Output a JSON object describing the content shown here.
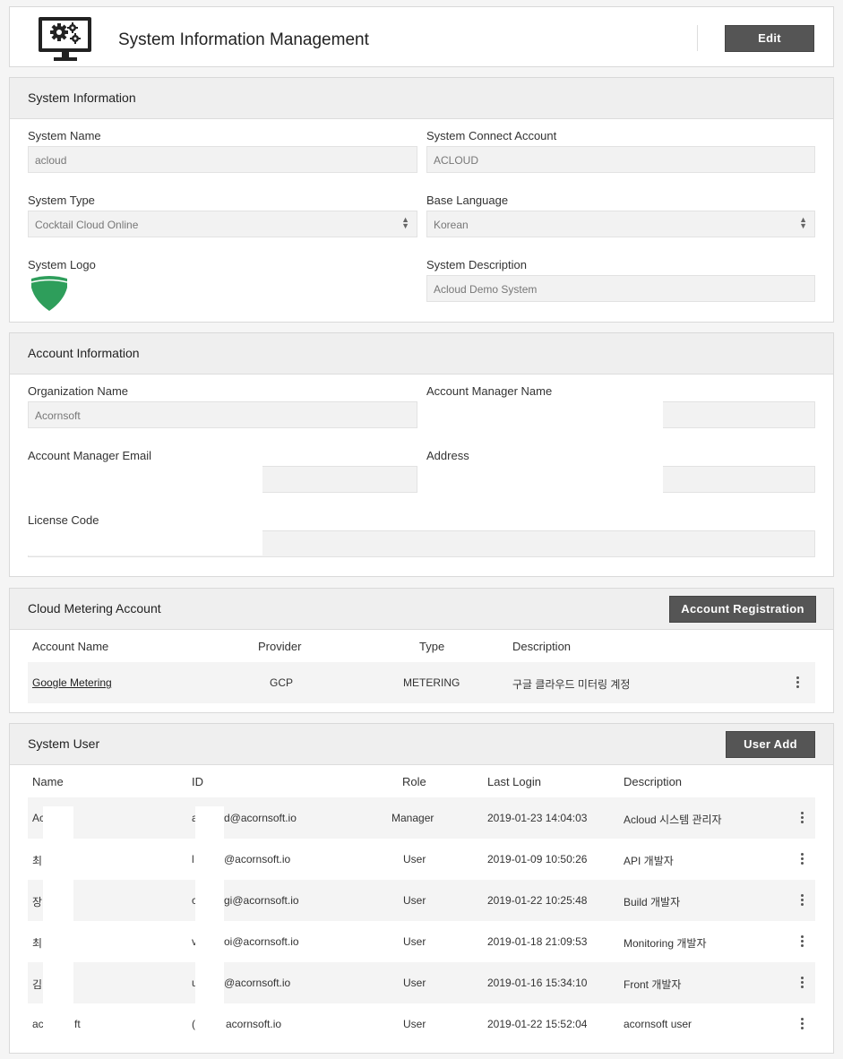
{
  "header": {
    "title": "System Information Management",
    "edit_label": "Edit"
  },
  "system_info": {
    "section_title": "System Information",
    "name_label": "System Name",
    "name_value": "acloud",
    "connect_label": "System Connect Account",
    "connect_value": "ACLOUD",
    "type_label": "System Type",
    "type_value": "Cocktail Cloud Online",
    "language_label": "Base Language",
    "language_value": "Korean",
    "logo_label": "System Logo",
    "description_label": "System Description",
    "description_value": "Acloud Demo System"
  },
  "account_info": {
    "section_title": "Account Information",
    "org_label": "Organization Name",
    "org_value": "Acornsoft",
    "manager_label": "Account Manager Name",
    "email_label": "Account Manager Email",
    "address_label": "Address",
    "license_label": "License Code"
  },
  "metering": {
    "section_title": "Cloud Metering Account",
    "register_label": "Account Registration",
    "columns": [
      "Account Name",
      "Provider",
      "Type",
      "Description"
    ],
    "rows": [
      {
        "name": "Google Metering",
        "provider": "GCP",
        "type": "METERING",
        "description": "구글 클라우드 미터링 계정"
      }
    ]
  },
  "users": {
    "section_title": "System User",
    "add_label": "User Add",
    "columns": [
      "Name",
      "ID",
      "Role",
      "Last Login",
      "Description"
    ],
    "rows": [
      {
        "name": "Ac",
        "id_prefix": "a",
        "id_suffix": "d@acornsoft.io",
        "role": "Manager",
        "last_login": "2019-01-23 14:04:03",
        "description": "Acloud 시스템 관리자"
      },
      {
        "name": "최",
        "id_prefix": "l",
        "id_suffix": "@acornsoft.io",
        "role": "User",
        "last_login": "2019-01-09 10:50:26",
        "description": "API 개발자"
      },
      {
        "name": "장",
        "id_prefix": "c",
        "id_suffix": "gi@acornsoft.io",
        "role": "User",
        "last_login": "2019-01-22 10:25:48",
        "description": "Build 개발자"
      },
      {
        "name": "최",
        "id_prefix": "v",
        "id_suffix": "oi@acornsoft.io",
        "role": "User",
        "last_login": "2019-01-18 21:09:53",
        "description": "Monitoring 개발자"
      },
      {
        "name": "김",
        "id_prefix": "u",
        "id_suffix": "@acornsoft.io",
        "role": "User",
        "last_login": "2019-01-16 15:34:10",
        "description": "Front 개발자"
      },
      {
        "name": "ac",
        "name_tail": "ft",
        "id_prefix": "(",
        "id_suffix": "acornsoft.io",
        "role": "User",
        "last_login": "2019-01-22 15:52:04",
        "description": "acornsoft user"
      }
    ]
  },
  "colors": {
    "button": "#555555",
    "panel_header": "#efefef",
    "logo_green": "#2e9e5b"
  },
  "icons": [
    "monitor-gears-icon",
    "select-arrows-icon",
    "acorn-logo-icon",
    "kebab-menu-icon"
  ]
}
